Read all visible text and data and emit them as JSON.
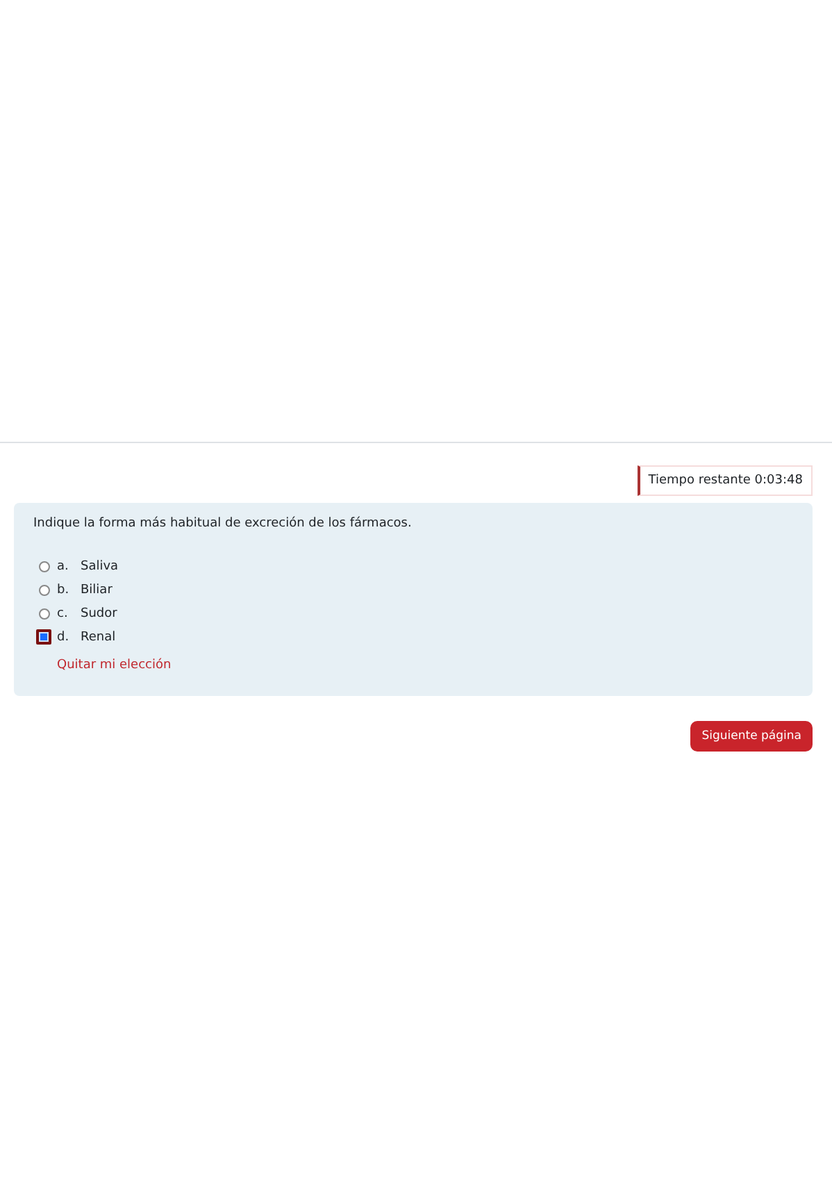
{
  "timer": {
    "text": "Tiempo restante 0:03:48"
  },
  "question": {
    "text": "Indique la forma más habitual de excreción de los fármacos.",
    "options": [
      {
        "letter": "a.",
        "label": "Saliva",
        "selected": false
      },
      {
        "letter": "b.",
        "label": "Biliar",
        "selected": false
      },
      {
        "letter": "c.",
        "label": "Sudor",
        "selected": false
      },
      {
        "letter": "d.",
        "label": "Renal",
        "selected": true
      }
    ],
    "clear_link": "Quitar mi elección"
  },
  "next_button": "Siguiente página"
}
